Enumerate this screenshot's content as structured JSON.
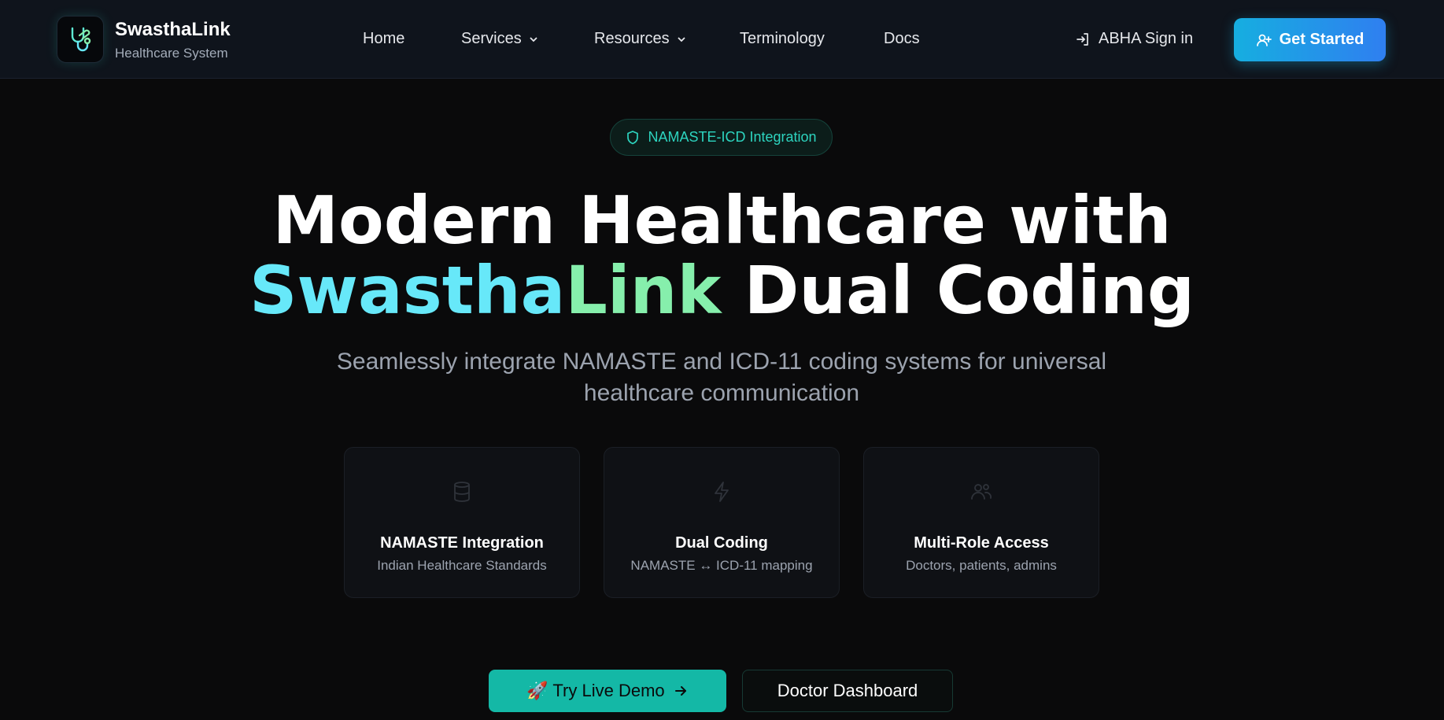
{
  "header": {
    "brand": {
      "name": "SwasthaLink",
      "subtitle": "Healthcare System",
      "logo_icon": "stethoscope-icon"
    },
    "nav": [
      {
        "label": "Home",
        "has_dropdown": false
      },
      {
        "label": "Services",
        "has_dropdown": true
      },
      {
        "label": "Resources",
        "has_dropdown": true
      },
      {
        "label": "Terminology",
        "has_dropdown": false
      },
      {
        "label": "Docs",
        "has_dropdown": false
      }
    ],
    "signin_label": "ABHA Sign in",
    "get_started_label": "Get Started"
  },
  "hero": {
    "badge": "NAMASTE-ICD Integration",
    "title_line1": "Modern Healthcare with",
    "title_swastha": "Swastha",
    "title_link": "Link",
    "title_rest": "Dual Coding",
    "subtitle": "Seamlessly integrate NAMASTE and ICD-11 coding systems for universal healthcare communication"
  },
  "features": [
    {
      "title": "NAMASTE Integration",
      "subtitle": "Indian Healthcare Standards",
      "icon": "database-icon"
    },
    {
      "title": "Dual Coding",
      "subtitle": "NAMASTE ↔ ICD-11 mapping",
      "icon": "zap-icon"
    },
    {
      "title": "Multi-Role Access",
      "subtitle": "Doctors, patients, admins",
      "icon": "users-icon"
    }
  ],
  "cta": {
    "demo_label": "🚀 Try Live Demo",
    "doctor_label": "Doctor Dashboard"
  },
  "colors": {
    "accent_teal": "#14b8a6",
    "cyan": "#67e8f9",
    "green": "#86efac",
    "button_gradient_start": "#16aee0",
    "button_gradient_end": "#2f7ff0"
  }
}
